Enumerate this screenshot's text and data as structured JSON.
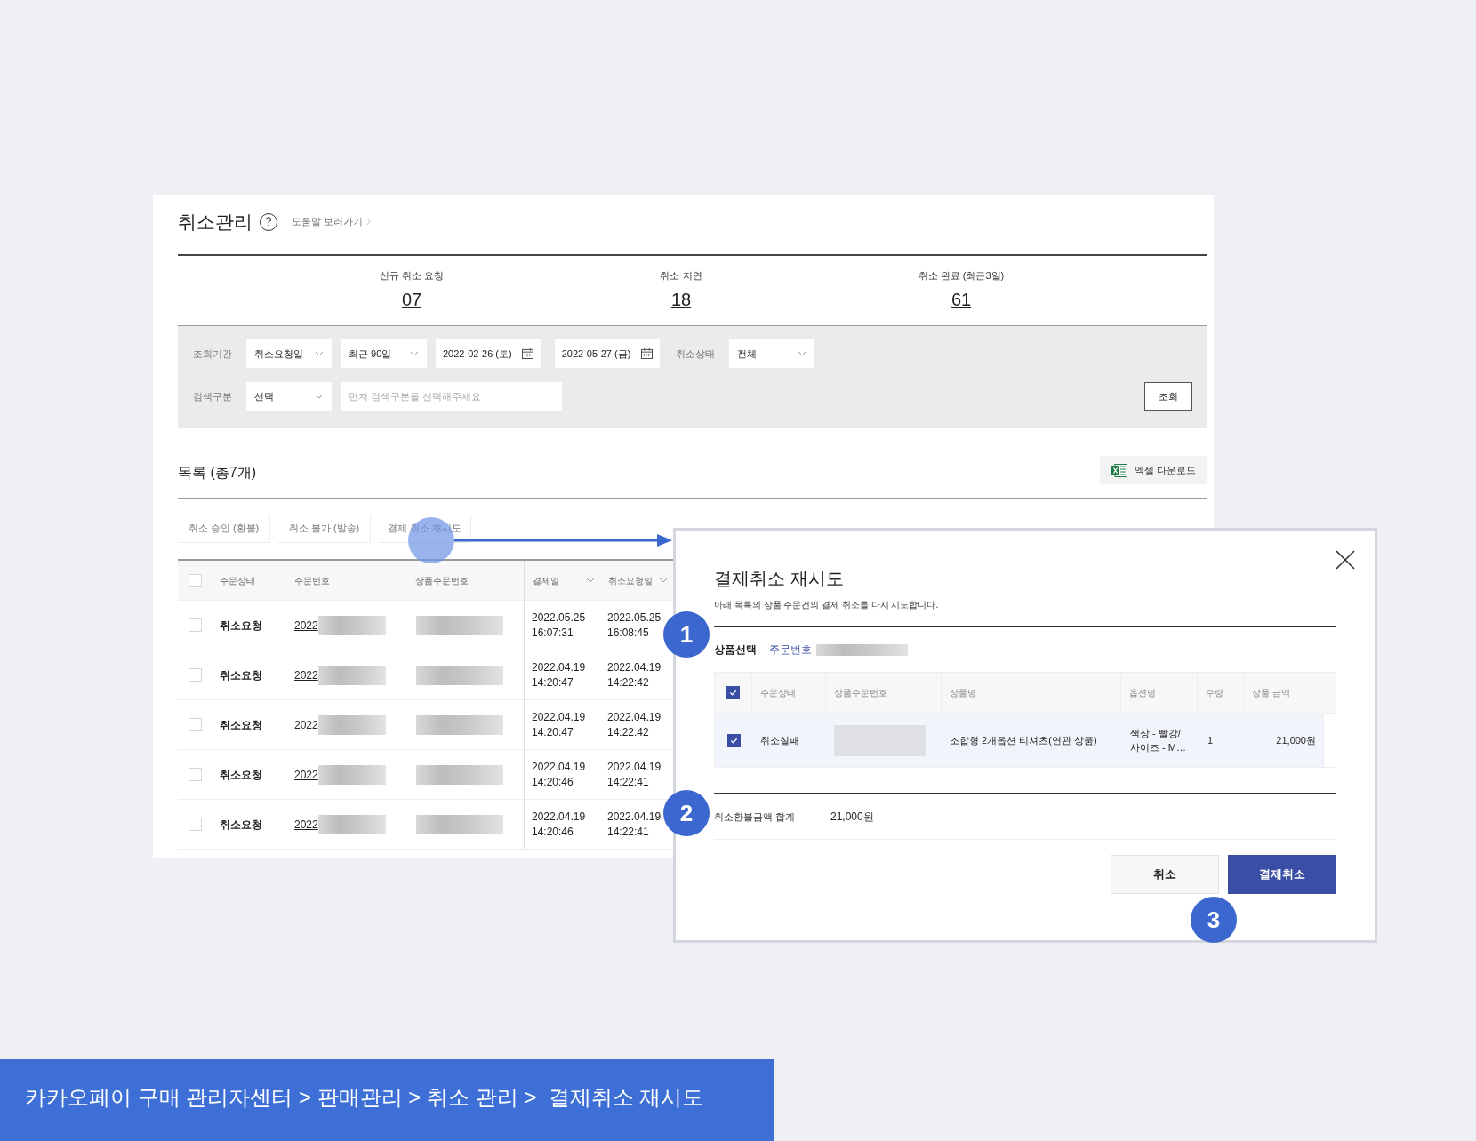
{
  "page": {
    "title": "취소관리",
    "help_link": "도움말 보러가기"
  },
  "summary": [
    {
      "label": "신규 취소 요청",
      "value": "07"
    },
    {
      "label": "취소 지연",
      "value": "18"
    },
    {
      "label": "취소 완료 (최근3일)",
      "value": "61"
    }
  ],
  "filters": {
    "rows": [
      [
        {
          "kind": "label",
          "text": "조회기간"
        },
        {
          "kind": "select",
          "value": "취소요청일"
        },
        {
          "kind": "select",
          "value": "최근 90일"
        },
        {
          "kind": "date",
          "value": "2022-02-26 (토)"
        },
        {
          "kind": "separator",
          "text": "-"
        },
        {
          "kind": "date",
          "value": "2022-05-27 (금)"
        },
        {
          "kind": "label",
          "text": "취소상태"
        },
        {
          "kind": "select",
          "value": "전체"
        }
      ],
      [
        {
          "kind": "label",
          "text": "검색구분"
        },
        {
          "kind": "select",
          "value": "선택"
        },
        {
          "kind": "input",
          "placeholder": "먼저 검색구분을 선택해주세요"
        }
      ]
    ],
    "search_button": "조회"
  },
  "list": {
    "title": "목록 (총7개)",
    "excel_button": "엑셀 다운로드",
    "actions": [
      "취소 승인 (환불)",
      "취소 불가 (발송)",
      "결제 취소 재시도"
    ]
  },
  "table": {
    "all_checked": false,
    "columns": [
      {
        "label": "주문상태",
        "sortable": false
      },
      {
        "label": "주문번호",
        "sortable": false
      },
      {
        "label": "상품주문번호",
        "sortable": false
      },
      {
        "label": "결제일",
        "sortable": true
      },
      {
        "label": "취소요청일",
        "sortable": true
      }
    ],
    "rows": [
      {
        "checked": false,
        "status": "취소요청",
        "order_no": "2022",
        "paid_date": "2022.05.25",
        "paid_time": "16:07:31",
        "requested_date": "2022.05.25",
        "requested_time": "16:08:45"
      },
      {
        "checked": false,
        "status": "취소요청",
        "order_no": "2022",
        "paid_date": "2022.04.19",
        "paid_time": "14:20:47",
        "requested_date": "2022.04.19",
        "requested_time": "14:22:42"
      },
      {
        "checked": false,
        "status": "취소요청",
        "order_no": "2022",
        "paid_date": "2022.04.19",
        "paid_time": "14:20:47",
        "requested_date": "2022.04.19",
        "requested_time": "14:22:42"
      },
      {
        "checked": false,
        "status": "취소요청",
        "order_no": "2022",
        "paid_date": "2022.04.19",
        "paid_time": "14:20:46",
        "requested_date": "2022.04.19",
        "requested_time": "14:22:41"
      },
      {
        "checked": false,
        "status": "취소요청",
        "order_no": "2022",
        "paid_date": "2022.04.19",
        "paid_time": "14:20:46",
        "requested_date": "2022.04.19",
        "requested_time": "14:22:41"
      }
    ]
  },
  "modal": {
    "title": "결제취소 재시도",
    "description": "아래 목록의 상품 주문건의 결제 취소를 다시 시도합니다.",
    "product_select_label": "상품선택",
    "order_no_label": "주문번호",
    "table": {
      "all_checked": true,
      "columns": [
        "주문상태",
        "상품주문번호",
        "상품명",
        "옵션명",
        "수량",
        "상품 금액"
      ],
      "rows": [
        {
          "checked": true,
          "status": "취소실패",
          "product": "조합형 2개옵션 티셔츠(연관 상품)",
          "option_lines": [
            "색상 - 빨강/",
            "사이즈 - M…"
          ],
          "qty": "1",
          "amount": "21,000원"
        }
      ]
    },
    "total_label": "취소환불금액 합계",
    "total": "21,000원",
    "buttons": [
      {
        "label": "취소",
        "kind": "secondary"
      },
      {
        "label": "결제취소",
        "kind": "primary"
      }
    ]
  },
  "annotations": [
    {
      "label": "1"
    },
    {
      "label": "2"
    },
    {
      "label": "3"
    }
  ],
  "banner": {
    "text": "카카오페이 구매 관리자센터 > 판매관리 > 취소 관리 >  결제취소 재시도"
  }
}
